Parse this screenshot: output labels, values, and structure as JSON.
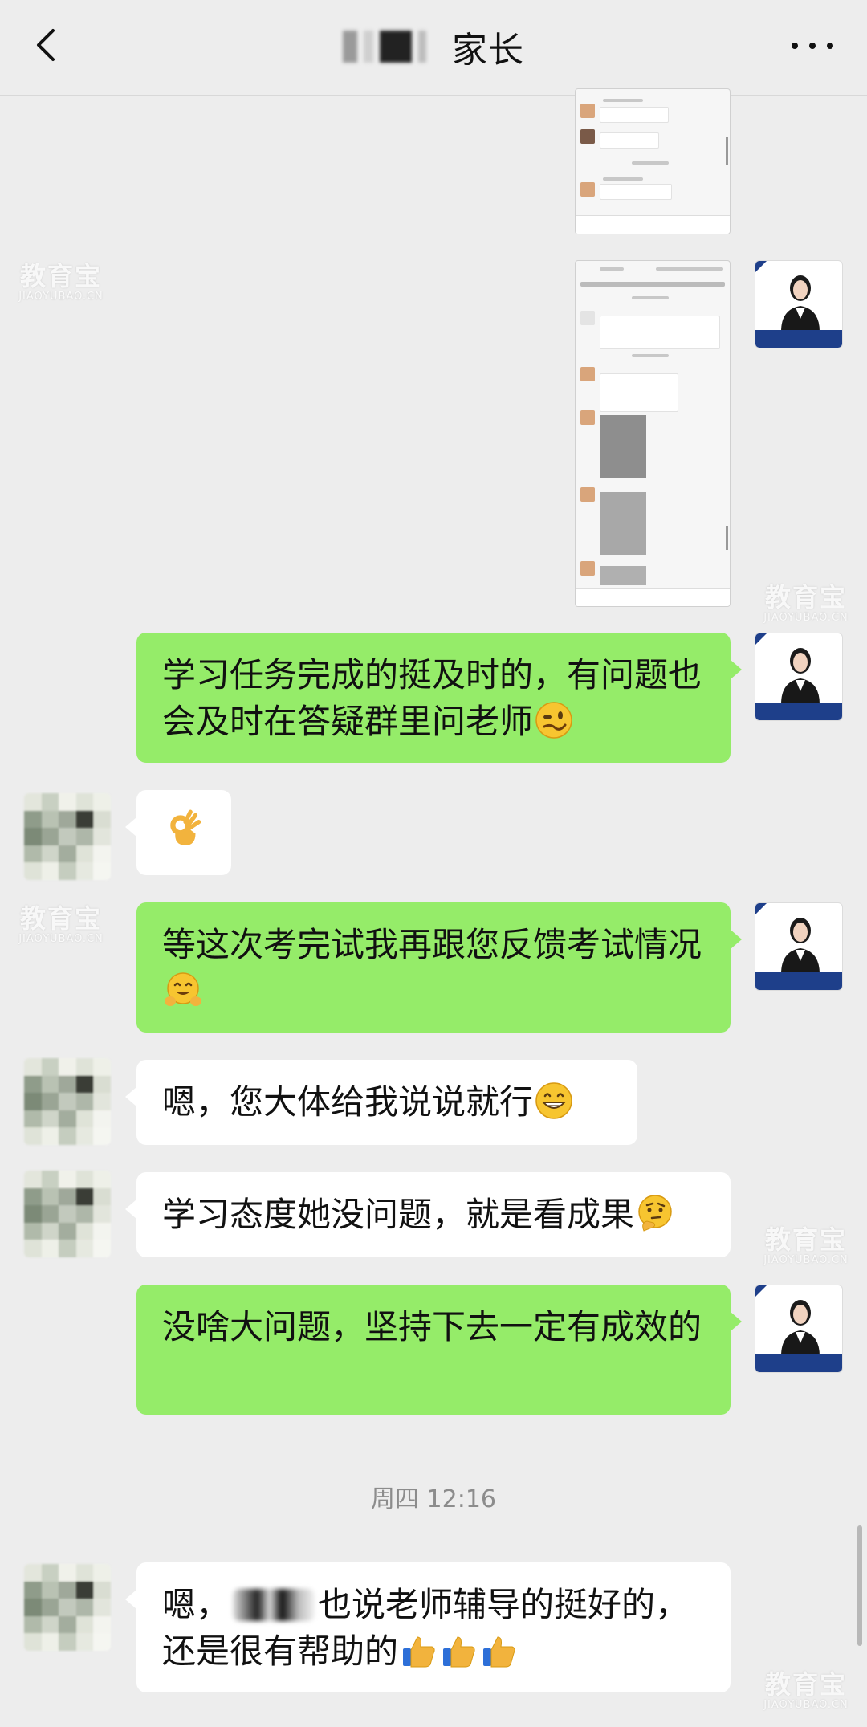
{
  "header": {
    "title": "家长",
    "back_icon": "chevron-left-icon",
    "more_icon": "more-dots-icon"
  },
  "watermark": {
    "cn": "教育宝",
    "en": "JIAOYUBAO.CN"
  },
  "messages": [
    {
      "id": "m1",
      "sender": "self",
      "type": "image",
      "content": "chat-screenshot"
    },
    {
      "id": "m2",
      "sender": "self",
      "type": "image",
      "content": "chat-screenshot"
    },
    {
      "id": "m3",
      "sender": "self",
      "type": "text",
      "text": "学习任务完成的挺及时的，有问题也会及时在答疑群里问老师",
      "emoji": "🥴"
    },
    {
      "id": "m4",
      "sender": "other",
      "type": "emoji",
      "emoji": "👌"
    },
    {
      "id": "m5",
      "sender": "self",
      "type": "text",
      "text": "等这次考完试我再跟您反馈考试情况",
      "emoji": "🤗"
    },
    {
      "id": "m6",
      "sender": "other",
      "type": "text",
      "text": "嗯，您大体给我说说就行",
      "emoji": "😁"
    },
    {
      "id": "m7",
      "sender": "other",
      "type": "text",
      "text": "学习态度她没问题，就是看成果",
      "emoji": "🤔"
    },
    {
      "id": "m8",
      "sender": "self",
      "type": "text",
      "text": "没啥大问题，坚持下去一定有成效的"
    },
    {
      "id": "m9",
      "sender": "other",
      "type": "text",
      "text_before": "嗯，",
      "text_after": "也说老师辅导的挺好的，还是很有帮助的",
      "emoji": "👍👍👍"
    }
  ],
  "timestamp": "周四 12:16",
  "colors": {
    "background": "#ededed",
    "self_bubble": "#95ec69",
    "other_bubble": "#ffffff",
    "timestamp": "#8c8c8c",
    "avatar_band": "#1e3f8a"
  }
}
